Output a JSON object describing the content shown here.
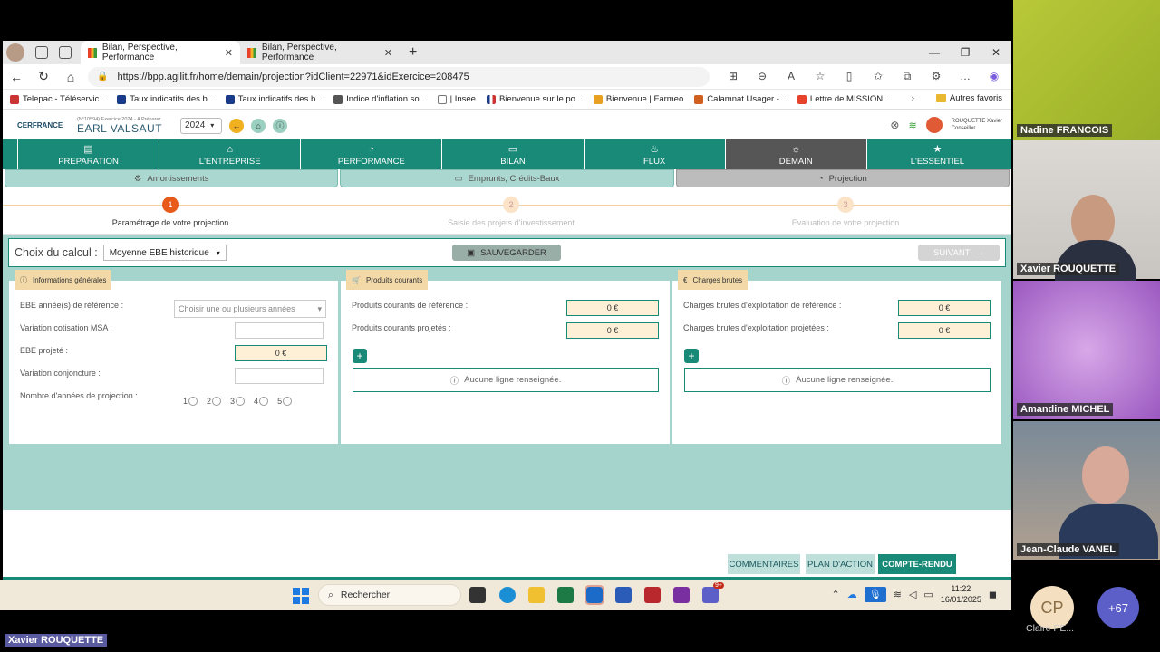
{
  "browser": {
    "tabs": [
      {
        "title": "Bilan, Perspective, Performance"
      },
      {
        "title": "Bilan, Perspective, Performance"
      }
    ],
    "url": "https://bpp.agilit.fr/home/demain/projection?idClient=22971&idExercice=208475",
    "bookmarks": [
      "Telepac - Téléservic...",
      "Taux indicatifs des b...",
      "Taux indicatifs des b...",
      "Indice d'inflation so...",
      "| Insee",
      "Bienvenue sur le po...",
      "Bienvenue | Farmeo",
      "Calamnat Usager -...",
      "Lettre de MISSION..."
    ],
    "other_favorites": "Autres favoris"
  },
  "app": {
    "logo": "CERFRANCE",
    "farm_sub": "(N°10594) Exercice 2024 - A Préparer",
    "farm_name": "EARL VALSAUT",
    "year": "2024",
    "user_name": "ROUQUETTE Xavier",
    "user_role": "Conseiller",
    "nav": [
      {
        "label": "PREPARATION",
        "icon": "document-icon"
      },
      {
        "label": "L'ENTREPRISE",
        "icon": "barn-icon"
      },
      {
        "label": "PERFORMANCE",
        "icon": "gauge-icon"
      },
      {
        "label": "BILAN",
        "icon": "file-icon"
      },
      {
        "label": "FLUX",
        "icon": "piggy-bank-icon"
      },
      {
        "label": "DEMAIN",
        "icon": "sun-icon"
      },
      {
        "label": "L'ESSENTIEL",
        "icon": "star-icon"
      }
    ],
    "subnav": [
      "Amortissements",
      "Emprunts, Crédits-Baux",
      "Projection"
    ],
    "steps": [
      {
        "num": "1",
        "label": "Paramétrage de votre projection"
      },
      {
        "num": "2",
        "label": "Saisie des projets d'investissement"
      },
      {
        "num": "3",
        "label": "Evaluation de votre projection"
      }
    ],
    "calc": {
      "label": "Choix du calcul :",
      "value": "Moyenne EBE historique",
      "save": "SAUVEGARDER",
      "next": "SUIVANT"
    },
    "general": {
      "title": "Informations générales",
      "ebe_ref_label": "EBE année(s) de référence :",
      "ebe_ref_placeholder": "Choisir une ou plusieurs années",
      "msa_label": "Variation cotisation MSA :",
      "ebe_proj_label": "EBE projeté :",
      "ebe_proj_value": "0 €",
      "conj_label": "Variation conjoncture :",
      "years_label": "Nombre d'années de projection :",
      "years": [
        "1",
        "2",
        "3",
        "4",
        "5"
      ]
    },
    "produits": {
      "title": "Produits courants",
      "ref_label": "Produits courants de référence :",
      "ref_value": "0 €",
      "proj_label": "Produits courants projetés :",
      "proj_value": "0 €",
      "empty": "Aucune ligne renseignée."
    },
    "charges": {
      "title": "Charges brutes",
      "ref_label": "Charges brutes d'exploitation de référence :",
      "ref_value": "0 €",
      "proj_label": "Charges brutes d'exploitation projetées :",
      "proj_value": "0 €",
      "empty": "Aucune ligne renseignée."
    },
    "bottom": [
      "COMMENTAIRES",
      "PLAN D'ACTION",
      "COMPTE-RENDU"
    ]
  },
  "taskbar": {
    "search": "Rechercher",
    "time": "11:22",
    "date": "16/01/2025",
    "badge": "9+"
  },
  "meeting": {
    "participants": [
      "Nadine FRANCOIS",
      "Xavier ROUQUETTE",
      "Amandine MICHEL",
      "Jean-Claude VANEL"
    ],
    "initials": "CP",
    "extra_name": "Claire PE...",
    "more": "+67",
    "speaker": "Xavier ROUQUETTE"
  }
}
